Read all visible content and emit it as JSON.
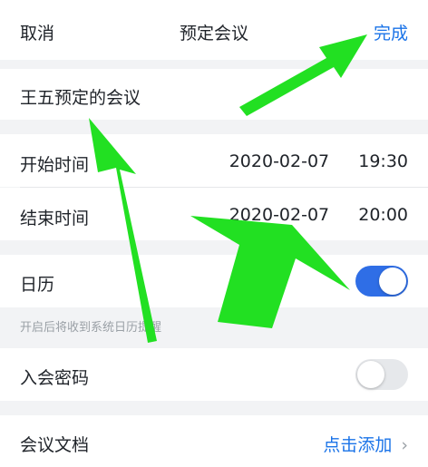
{
  "header": {
    "cancel": "取消",
    "title": "预定会议",
    "done": "完成"
  },
  "meeting": {
    "topic": "王五预定的会议"
  },
  "time": {
    "start_label": "开始时间",
    "start_date": "2020-02-07",
    "start_time": "19:30",
    "end_label": "结束时间",
    "end_date": "2020-02-07",
    "end_time": "20:00"
  },
  "calendar": {
    "label": "日历",
    "enabled": true,
    "hint": "开启后将收到系统日历提醒"
  },
  "password": {
    "label": "入会密码",
    "enabled": false
  },
  "docs": {
    "label": "会议文档",
    "action": "点击添加",
    "chevron": "chevron-right-icon"
  },
  "colors": {
    "accent": "#1a73e8",
    "toggle_on": "#2f6ee6",
    "annotation_arrow": "#22e022"
  }
}
